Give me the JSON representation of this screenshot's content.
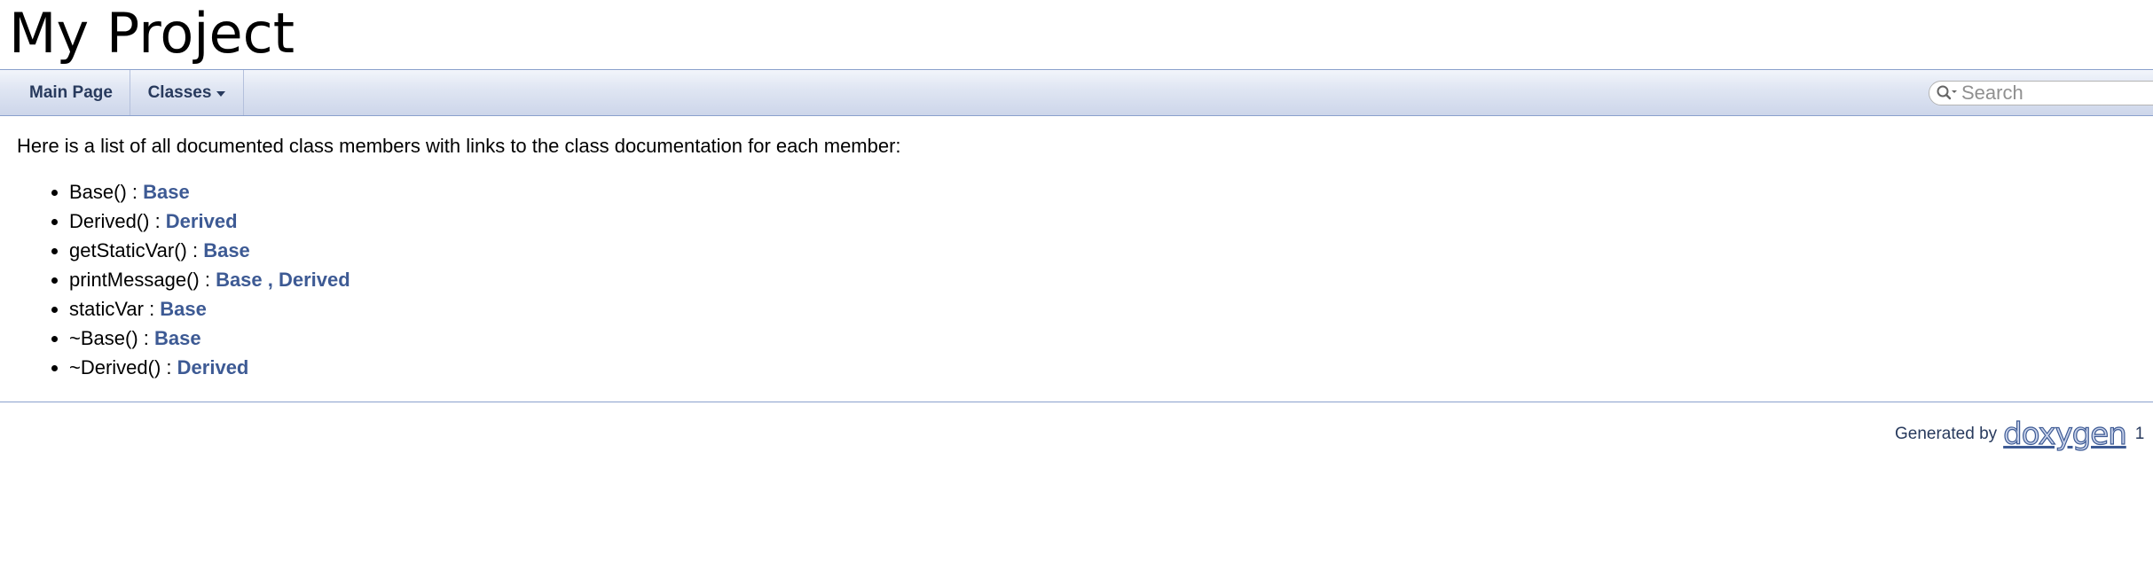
{
  "header": {
    "project_name": "My Project"
  },
  "navbar": {
    "tabs": [
      {
        "label": "Main Page"
      },
      {
        "label": "Classes"
      }
    ],
    "search": {
      "placeholder": "Search",
      "value": ""
    }
  },
  "contents": {
    "intro": "Here is a list of all documented class members with links to the class documentation for each member:",
    "members": [
      {
        "name": "Base() : ",
        "links": [
          "Base"
        ]
      },
      {
        "name": "Derived() : ",
        "links": [
          "Derived"
        ]
      },
      {
        "name": "getStaticVar() : ",
        "links": [
          "Base"
        ]
      },
      {
        "name": "printMessage() : ",
        "links": [
          "Base",
          "Derived"
        ]
      },
      {
        "name": "staticVar : ",
        "links": [
          "Base"
        ]
      },
      {
        "name": "~Base() : ",
        "links": [
          "Base"
        ]
      },
      {
        "name": "~Derived() : ",
        "links": [
          "Derived"
        ]
      }
    ],
    "link_separator": " , "
  },
  "footer": {
    "generated_by": "Generated by",
    "logo_text": "doxygen",
    "version": "1"
  },
  "colors": {
    "link": "#3d5a94",
    "nav_text": "#283a5d",
    "nav_border": "#8aa0cc"
  },
  "icons": {
    "search": "search-icon",
    "dropdown": "chevron-down-icon"
  }
}
